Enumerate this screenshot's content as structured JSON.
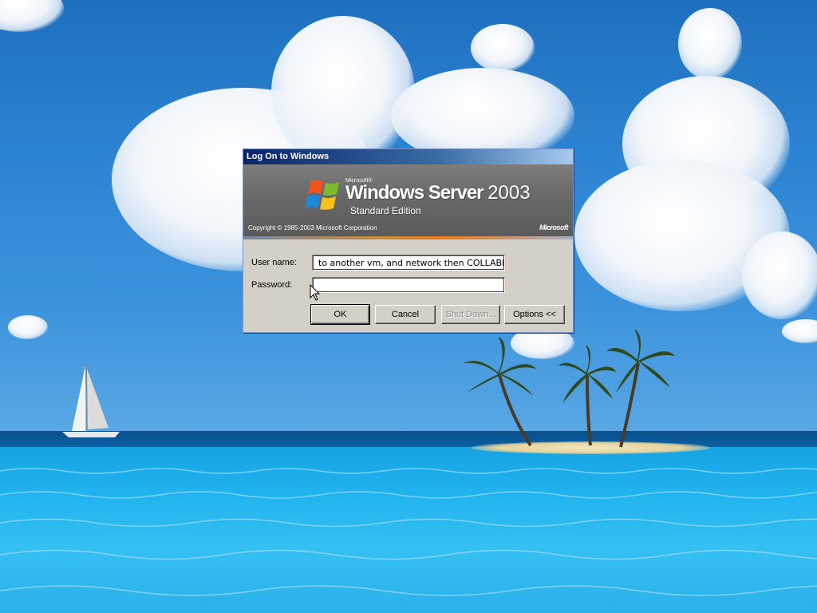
{
  "dialog": {
    "title": "Log On to Windows",
    "banner": {
      "microsoft_small": "Microsoft®",
      "product_name": "Windows Server",
      "product_version": "2003",
      "edition": "Standard Edition",
      "copyright": "Copyright © 1985-2003  Microsoft Corporation",
      "microsoft_logo": "Microsoft"
    },
    "user_name_label": "User name:",
    "user_name_value": "to another vm, and network then COLLABMA",
    "password_label": "Password:",
    "password_value": "",
    "buttons": {
      "ok": "OK",
      "cancel": "Cancel",
      "shutdown": "Shut Down...",
      "options": "Options <<"
    }
  },
  "icons": {
    "flag": "windows-flag-icon",
    "cursor": "mouse-pointer-icon"
  },
  "colors": {
    "title_bar": "#0a246a",
    "dialog_face": "#d4d0c8",
    "banner": "#6a6a6a",
    "accent_orange": "#f07a12"
  }
}
